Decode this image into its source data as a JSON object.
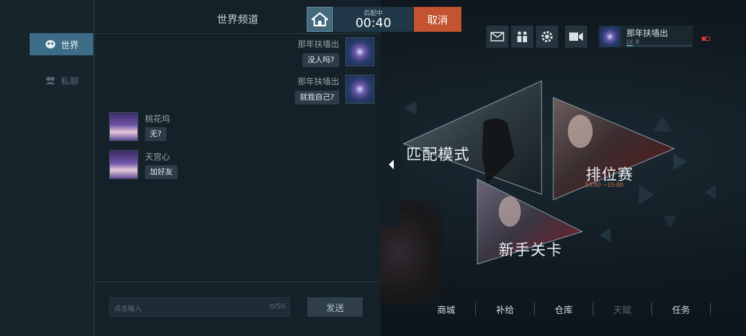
{
  "tabs": [
    {
      "label": "世界",
      "active": true
    },
    {
      "label": "私聊",
      "active": false
    }
  ],
  "chat": {
    "title": "世界频道",
    "messages": [
      {
        "name": "那年扶墙出",
        "text": "没人吗?",
        "side": "right",
        "avatar": "emblem-avatar"
      },
      {
        "name": "那年扶墙出",
        "text": "就我自己?",
        "side": "right",
        "avatar": "emblem-avatar"
      },
      {
        "name": "桃花坞",
        "text": "无?",
        "side": "left",
        "avatar": "girl-avatar"
      },
      {
        "name": "天宫心",
        "text": "加好友",
        "side": "left",
        "avatar": "girl-avatar"
      }
    ],
    "input_placeholder": "点击输入",
    "char_count": "0/50",
    "send_label": "发送"
  },
  "match": {
    "status": "匹配中",
    "timer": "00:40",
    "cancel_label": "取消"
  },
  "toolbar": {
    "icons": [
      "mail-icon",
      "friends-icon",
      "settings-icon",
      "video-icon"
    ]
  },
  "player": {
    "name": "那年扶墙出",
    "level": "LV. 8",
    "xp_fraction": 0.1
  },
  "modes": [
    {
      "label": "匹配模式"
    },
    {
      "label": "排位赛",
      "schedule": "13:00 ~15:00"
    },
    {
      "label": "新手关卡"
    }
  ],
  "bottom_nav": [
    {
      "label": "商城",
      "enabled": true
    },
    {
      "label": "补给",
      "enabled": true
    },
    {
      "label": "仓库",
      "enabled": true
    },
    {
      "label": "天赋",
      "enabled": false
    },
    {
      "label": "任务",
      "enabled": true
    }
  ],
  "colors": {
    "accent": "#3d6c86",
    "cancel": "#c4532f",
    "schedule": "#e07a4a"
  }
}
